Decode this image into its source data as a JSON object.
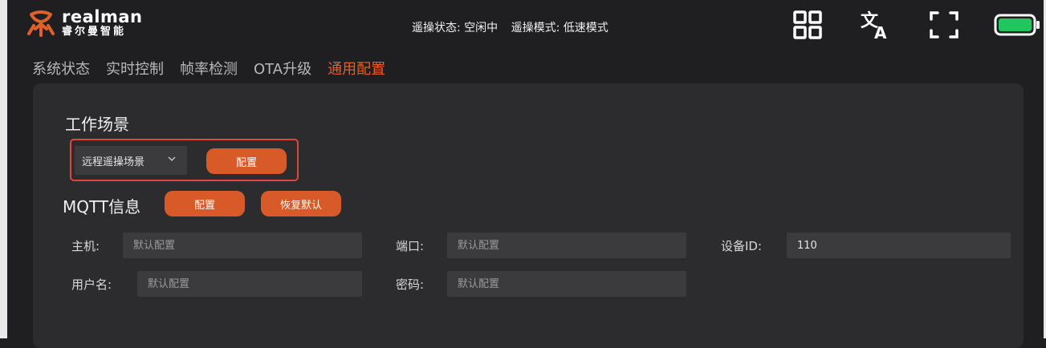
{
  "header": {
    "logo_en": "realman",
    "logo_cn": "睿尔曼智能",
    "teleop_status": "遥操状态: 空闲中",
    "teleop_mode": "遥操模式: 低速模式",
    "icons": [
      "grid-icon",
      "translate-icon",
      "fullscreen-icon",
      "battery-icon"
    ],
    "battery_color": "#22c55e"
  },
  "tabs": [
    {
      "label": "系统状态"
    },
    {
      "label": "实时控制"
    },
    {
      "label": "帧率检测"
    },
    {
      "label": "OTA升级"
    },
    {
      "label": "通用配置"
    }
  ],
  "active_tab": "通用配置",
  "accent_color": "#d85a28",
  "scene": {
    "title": "工作场景",
    "selected": "远程遥操场景",
    "config_label": "配置"
  },
  "mqtt": {
    "title": "MQTT信息",
    "config_label": "配置",
    "reset_label": "恢复默认",
    "host_label": "主机:",
    "host_placeholder": "默认配置",
    "port_label": "端口:",
    "port_placeholder": "默认配置",
    "device_label": "设备ID:",
    "device_value": "110",
    "user_label": "用户名:",
    "user_placeholder": "默认配置",
    "pass_label": "密码:",
    "pass_placeholder": "默认配置"
  }
}
